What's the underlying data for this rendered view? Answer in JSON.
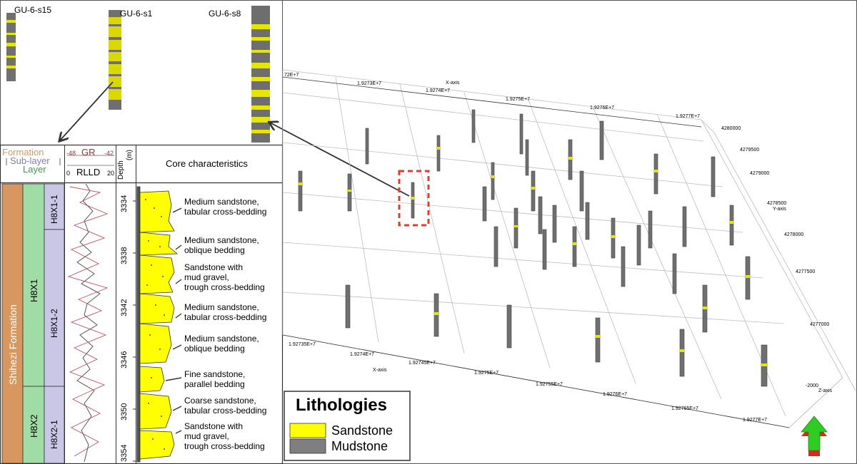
{
  "wells_top": [
    {
      "name": "GU-6-s15"
    },
    {
      "name": "GU-6-s1"
    },
    {
      "name": "GU-6-s8"
    }
  ],
  "column_headers": {
    "formation": "Formation",
    "sub_layer": "Sub-layer",
    "layer": "Layer",
    "gr": "GR",
    "gr_min": "-48",
    "gr_max": "-42",
    "rlld": "RLLD",
    "rlld_min": "0",
    "rlld_max": "20",
    "depth": "Depth",
    "depth_unit": "(m)",
    "core": "Core characteristics"
  },
  "formation_name": "Shihezi Formation",
  "sublayers": [
    "H8X1",
    "H8X2"
  ],
  "layers": [
    "H8X1-1",
    "H8X1-2",
    "H8X2-1"
  ],
  "depth_ticks": [
    "3334",
    "3338",
    "3342",
    "3346",
    "3350",
    "3354"
  ],
  "core_notes": [
    {
      "l1": "Medium sandstone,",
      "l2": "tabular cross-bedding",
      "l3": ""
    },
    {
      "l1": "Medium sandstone,",
      "l2": "oblique bedding",
      "l3": ""
    },
    {
      "l1": "Sandstone with",
      "l2": "mud gravel,",
      "l3": "trough cross-bedding"
    },
    {
      "l1": "Medium sandstone,",
      "l2": "tabular cross-bedding",
      "l3": ""
    },
    {
      "l1": "Medium sandstone,",
      "l2": "oblique bedding",
      "l3": ""
    },
    {
      "l1": "Fine sandstone,",
      "l2": "parallel bedding",
      "l3": ""
    },
    {
      "l1": "Coarse sandstone,",
      "l2": "tabular cross-bedding",
      "l3": ""
    },
    {
      "l1": "Sandstone with",
      "l2": "mud gravel,",
      "l3": "trough cross-bedding"
    }
  ],
  "axes": {
    "x_axis_label": "X-axis",
    "y_axis_label": "Y-axis",
    "z_axis_label": "Z-axis",
    "x_ticks_top": [
      "72E+7",
      "1.9273E+7",
      "1.9274E+7",
      "1.9275E+7",
      "1.9276E+7",
      "1.9277E+7"
    ],
    "x_ticks_bottom": [
      "1.92735E+7",
      "1.9274E+7",
      "1.92745E+7",
      "1.9275E+7",
      "1.92755E+7",
      "1.9276E+7",
      "1.92765E+7",
      "1.9277E+7"
    ],
    "y_ticks": [
      "4280000",
      "4279500",
      "4279000",
      "4278500",
      "4278000",
      "4277500",
      "4277000"
    ],
    "z_tick": "-2000"
  },
  "legend": {
    "title": "Lithologies",
    "items": [
      {
        "label": "Sandstone",
        "color": "#ffff00"
      },
      {
        "label": "Mudstone",
        "color": "#7f7f7f"
      }
    ]
  },
  "colors": {
    "sand": "#ffff00",
    "mud": "#7f7f7f",
    "formation": "#d8975e",
    "sublayer": "#9fdca6",
    "layer": "#c9c6e6",
    "highlight": "#e53b2d",
    "north_arrow": "#2fcc24"
  }
}
